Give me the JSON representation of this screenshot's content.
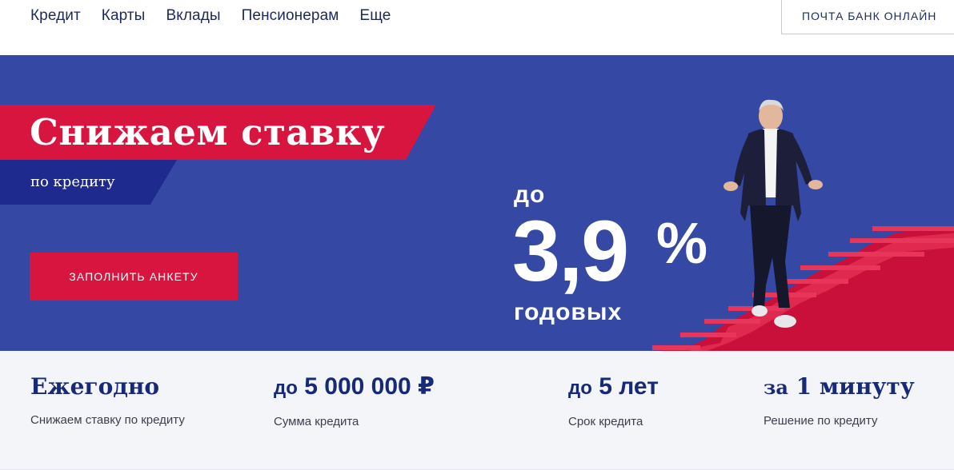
{
  "nav": {
    "links": [
      "Кредит",
      "Карты",
      "Вклады",
      "Пенсионерам",
      "Еще"
    ],
    "online_button": "ПОЧТА БАНК ОНЛАЙН"
  },
  "hero": {
    "title": "Снижаем ставку",
    "subtitle": "по кредиту",
    "cta_label": "ЗАПОЛНИТЬ АНКЕТУ",
    "rate_prefix": "до",
    "rate_value": "3,9",
    "rate_percent": "%",
    "rate_suffix": "годовых"
  },
  "features": [
    {
      "prefix": "",
      "value": "Ежегодно",
      "label": "Снижаем ставку по кредиту"
    },
    {
      "prefix": "до",
      "value": "5 000 000 ₽",
      "label": "Сумма кредита"
    },
    {
      "prefix": "до",
      "value": "5 лет",
      "label": "Срок кредита"
    },
    {
      "prefix": "за",
      "value": "1 минуту",
      "label": "Решение по кредиту"
    }
  ],
  "colors": {
    "hero_bg": "#3548a4",
    "accent_red": "#d7153f",
    "dark_blue": "#1e2a8e",
    "text_navy": "#162a78"
  }
}
